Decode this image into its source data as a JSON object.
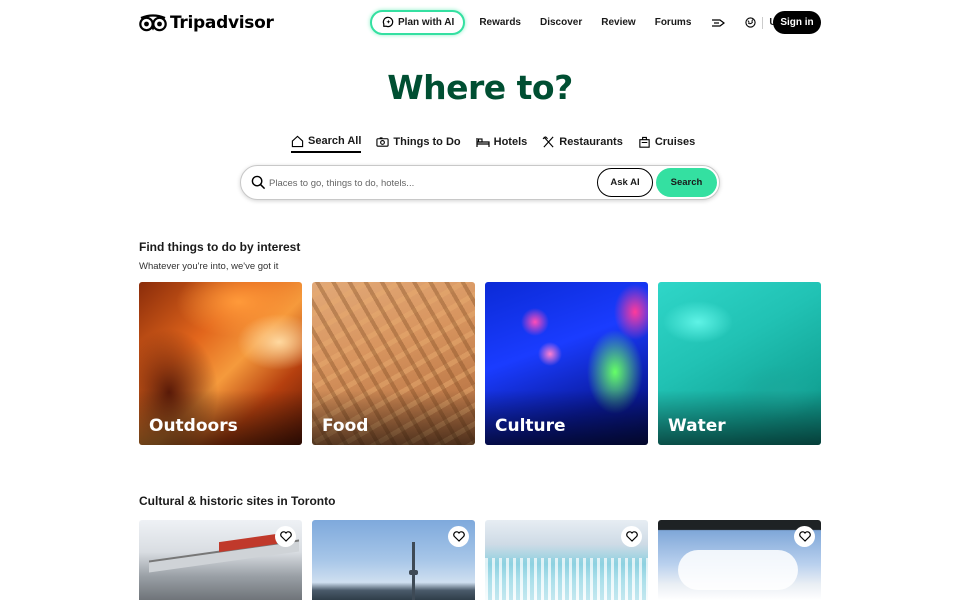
{
  "brand": {
    "name": "Tripadvisor",
    "accent": "#34e0a1",
    "title_color": "#004f32"
  },
  "header": {
    "plan_ai_label": "Plan with AI",
    "nav": [
      {
        "label": "Rewards"
      },
      {
        "label": "Discover"
      },
      {
        "label": "Review"
      },
      {
        "label": "Forums"
      }
    ],
    "trips_icon": "trips-icon",
    "globe_icon": "globe-icon",
    "currency": "USD",
    "signin_label": "Sign in"
  },
  "hero": {
    "title": "Where to?",
    "tabs": [
      {
        "label": "Search All",
        "icon": "home-icon",
        "active": true
      },
      {
        "label": "Things to Do",
        "icon": "ticket-icon",
        "active": false
      },
      {
        "label": "Hotels",
        "icon": "bed-icon",
        "active": false
      },
      {
        "label": "Restaurants",
        "icon": "utensils-icon",
        "active": false
      },
      {
        "label": "Cruises",
        "icon": "ship-icon",
        "active": false
      }
    ],
    "search": {
      "placeholder": "Places to go, things to do, hotels...",
      "ask_ai_label": "Ask AI",
      "button_label": "Search"
    }
  },
  "interests": {
    "title": "Find things to do by interest",
    "subtitle": "Whatever you're into, we've got it",
    "cards": [
      {
        "label": "Outdoors"
      },
      {
        "label": "Food"
      },
      {
        "label": "Culture"
      },
      {
        "label": "Water"
      }
    ]
  },
  "sites": {
    "title": "Cultural & historic sites in Toronto",
    "count_visible": 4
  }
}
